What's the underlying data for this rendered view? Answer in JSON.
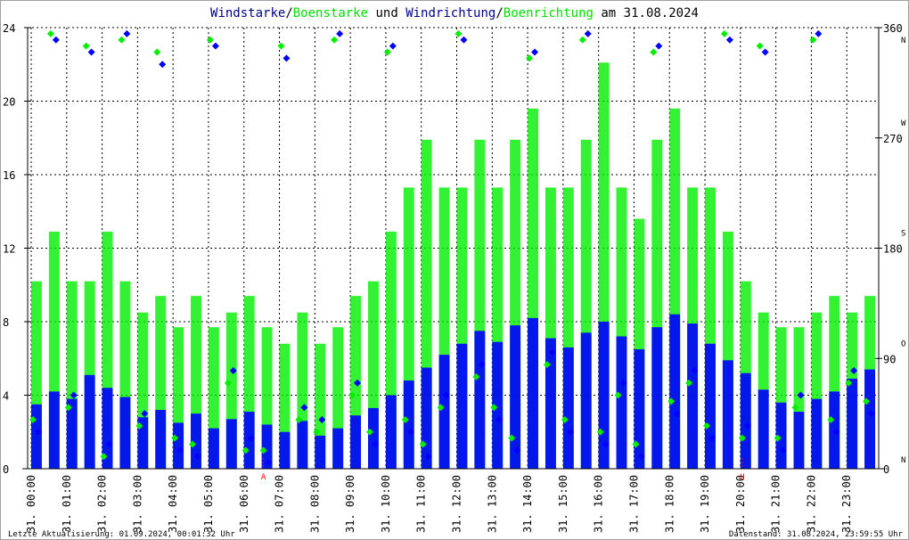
{
  "chart_data": {
    "type": "scatter",
    "title_parts": [
      {
        "text": "Windstarke",
        "color": "#00008b"
      },
      {
        "text": "/",
        "color": "#000000"
      },
      {
        "text": "Boenstarke",
        "color": "#00dd00"
      },
      {
        "text": " und ",
        "color": "#000000"
      },
      {
        "text": "Windrichtung",
        "color": "#00008b"
      },
      {
        "text": "/",
        "color": "#000000"
      },
      {
        "text": "Boenrichtung",
        "color": "#00dd00"
      },
      {
        "text": " am 31.08.2024",
        "color": "#000000"
      }
    ],
    "xlabel": "",
    "ylabel": "",
    "x_hours": [
      0,
      0.5,
      1,
      1.5,
      2,
      2.5,
      3,
      3.5,
      4,
      4.5,
      5,
      5.5,
      6,
      6.5,
      7,
      7.5,
      8,
      8.5,
      9,
      9.5,
      10,
      10.5,
      11,
      11.5,
      12,
      12.5,
      13,
      13.5,
      14,
      14.5,
      15,
      15.5,
      16,
      16.5,
      17,
      17.5,
      18,
      18.5,
      19,
      19.5,
      20,
      20.5,
      21,
      21.5,
      22,
      22.5,
      23,
      23.5
    ],
    "x_tick_labels": [
      "31. 00:00",
      "31. 01:00",
      "31. 02:00",
      "31. 03:00",
      "31. 04:00",
      "31. 05:00",
      "31. 06:00",
      "31. 07:00",
      "31. 08:00",
      "31. 09:00",
      "31. 10:00",
      "31. 11:00",
      "31. 12:00",
      "31. 13:00",
      "31. 14:00",
      "31. 15:00",
      "31. 16:00",
      "31. 17:00",
      "31. 18:00",
      "31. 19:00",
      "31. 20:00",
      "31. 21:00",
      "31. 22:00",
      "31. 23:00"
    ],
    "xlim": [
      0,
      24
    ],
    "ylim_left": [
      0,
      24
    ],
    "y_left_ticks": [
      0,
      4,
      8,
      12,
      16,
      20,
      24
    ],
    "ylim_right": [
      0,
      360
    ],
    "y_right_ticks": [
      0,
      90,
      180,
      270,
      360
    ],
    "compass_labels": [
      {
        "deg": 360,
        "text": "N"
      },
      {
        "deg": 270,
        "text": "W"
      },
      {
        "deg": 180,
        "text": "S"
      },
      {
        "deg": 90,
        "text": "O"
      },
      {
        "deg": 0,
        "text": "N"
      }
    ],
    "grid": true,
    "series": [
      {
        "name": "Windstarke",
        "kind": "bar",
        "color": "#0000ff",
        "values": [
          3.5,
          4.2,
          3.8,
          5.1,
          4.4,
          3.9,
          2.8,
          3.2,
          2.5,
          3.0,
          2.2,
          2.7,
          3.1,
          2.4,
          2.0,
          2.6,
          1.8,
          2.2,
          2.9,
          3.3,
          4.0,
          4.8,
          5.5,
          6.2,
          6.8,
          7.5,
          6.9,
          7.8,
          8.2,
          7.1,
          6.6,
          7.4,
          8.0,
          7.2,
          6.5,
          7.7,
          8.4,
          7.9,
          6.8,
          5.9,
          5.2,
          4.3,
          3.6,
          3.1,
          3.8,
          4.2,
          4.9,
          5.4
        ]
      },
      {
        "name": "Boenstarke",
        "kind": "bar",
        "color": "#00ee00",
        "values": [
          10.2,
          12.9,
          10.2,
          10.2,
          12.9,
          10.2,
          8.5,
          9.4,
          7.7,
          9.4,
          7.7,
          8.5,
          9.4,
          7.7,
          6.8,
          8.5,
          6.8,
          7.7,
          9.4,
          10.2,
          12.9,
          15.3,
          17.9,
          15.3,
          15.3,
          17.9,
          15.3,
          17.9,
          19.6,
          15.3,
          15.3,
          17.9,
          22.1,
          15.3,
          13.6,
          17.9,
          19.6,
          15.3,
          15.3,
          12.9,
          10.2,
          8.5,
          7.7,
          7.7,
          8.5,
          9.4,
          8.5,
          9.4
        ]
      },
      {
        "name": "Windrichtung",
        "kind": "diamond",
        "color": "#0000ff",
        "axis": "right",
        "values": [
          30,
          350,
          60,
          340,
          20,
          355,
          45,
          330,
          15,
          10,
          345,
          80,
          25,
          5,
          335,
          50,
          40,
          355,
          70,
          20,
          345,
          30,
          10,
          60,
          350,
          85,
          40,
          15,
          340,
          95,
          30,
          355,
          20,
          70,
          10,
          345,
          45,
          80,
          25,
          350,
          35,
          340,
          15,
          60,
          355,
          30,
          80,
          45
        ]
      },
      {
        "name": "Boenrichtung",
        "kind": "diamond",
        "color": "#00ee00",
        "axis": "right",
        "values": [
          40,
          355,
          50,
          345,
          10,
          350,
          35,
          340,
          25,
          20,
          350,
          70,
          15,
          15,
          345,
          40,
          30,
          350,
          60,
          30,
          340,
          40,
          20,
          50,
          355,
          75,
          50,
          25,
          335,
          85,
          40,
          350,
          30,
          60,
          20,
          340,
          55,
          70,
          35,
          355,
          25,
          345,
          25,
          50,
          350,
          40,
          70,
          55
        ]
      }
    ],
    "markers": [
      {
        "label": "A",
        "hour": 6.65,
        "color": "#ff0000"
      },
      {
        "label": "U",
        "hour": 20.15,
        "color": "#ff0000"
      }
    ]
  },
  "footer": {
    "left": "Letzte Aktualisierung: 01.09.2024, 00:01:32 Uhr",
    "right": "Datenstand: 31.08.2024, 23:59:55 Uhr"
  }
}
